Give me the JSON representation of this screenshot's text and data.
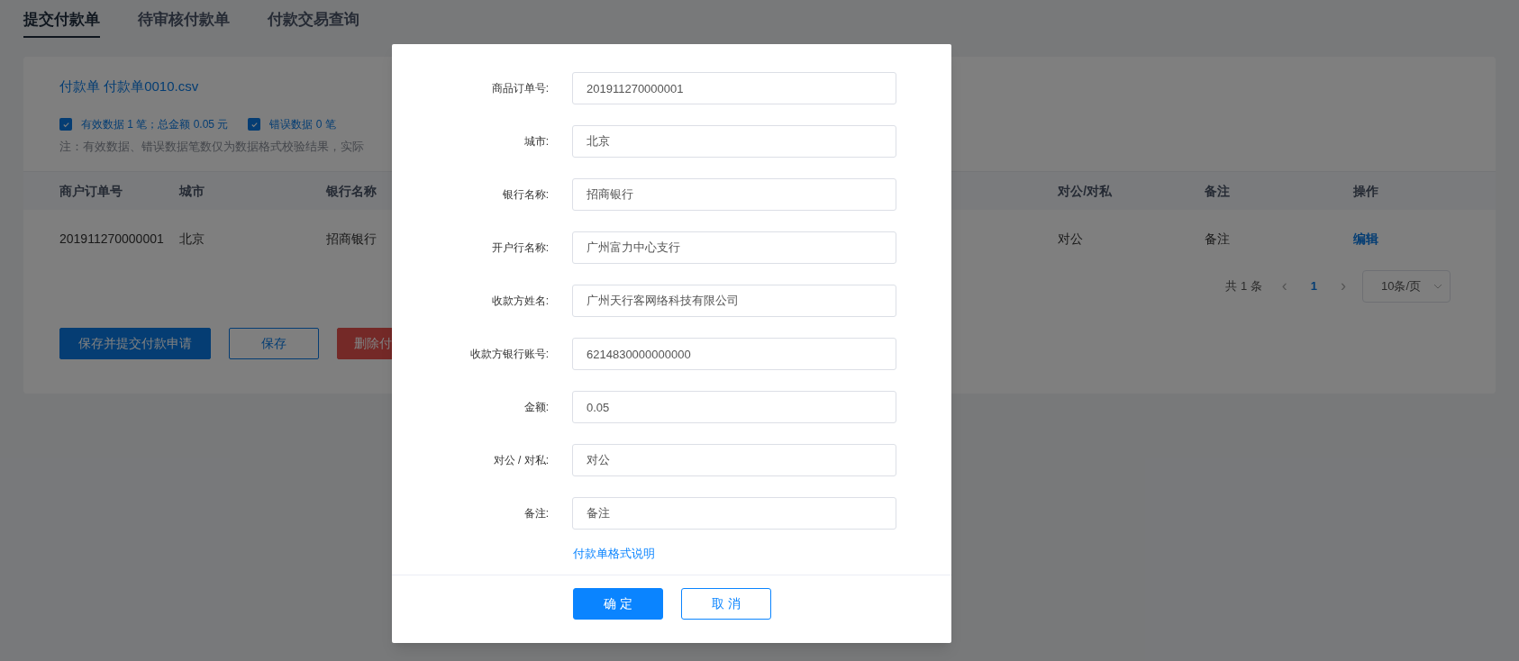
{
  "tabs": [
    {
      "label": "提交付款单",
      "selected": true
    },
    {
      "label": "待审核付款单",
      "selected": false
    },
    {
      "label": "付款交易查询",
      "selected": false
    }
  ],
  "card": {
    "title": "付款单 付款单0010.csv",
    "checks": [
      {
        "label": "有效数据 1 笔；总金额 0.05 元",
        "checked": true
      },
      {
        "label": "错误数据 0 笔",
        "checked": true
      }
    ],
    "note": "注：有效数据、错误数据笔数仅为数据格式校验结果，实际",
    "table": {
      "columns": [
        "商户订单号",
        "城市",
        "银行名称",
        "对公/对私",
        "备注",
        "操作"
      ],
      "rows": [
        {
          "cells": [
            "201911270000001",
            "北京",
            "招商银行",
            "对公",
            "备注"
          ],
          "action": "编辑"
        }
      ]
    },
    "pagination": {
      "total": "共 1 条",
      "prev": "‹",
      "pages": [
        {
          "label": "1",
          "selected": true
        }
      ],
      "next": "›",
      "page_size": "10条/页"
    },
    "buttons": [
      {
        "label": "保存并提交付款申请",
        "kind": "primary"
      },
      {
        "label": "保存",
        "kind": "outline"
      },
      {
        "label": "删除付",
        "kind": "danger"
      }
    ]
  },
  "dialog": {
    "fields": [
      {
        "label": "商品订单号:",
        "value": "201911270000001"
      },
      {
        "label": "城市:",
        "value": "北京"
      },
      {
        "label": "银行名称:",
        "value": "招商银行"
      },
      {
        "label": "开户行名称:",
        "value": "广州富力中心支行"
      },
      {
        "label": "收款方姓名:",
        "value": "广州天行客网络科技有限公司"
      },
      {
        "label": "收款方银行账号:",
        "value": "6214830000000000"
      },
      {
        "label": "金额:",
        "value": "0.05"
      },
      {
        "label": "对公 / 对私:",
        "value": "对公"
      },
      {
        "label": "备注:",
        "value": "备注"
      }
    ],
    "link": "付款单格式说明",
    "buttons": [
      {
        "label": "确 定",
        "kind": "primary"
      },
      {
        "label": "取 消",
        "kind": "outline"
      }
    ]
  }
}
